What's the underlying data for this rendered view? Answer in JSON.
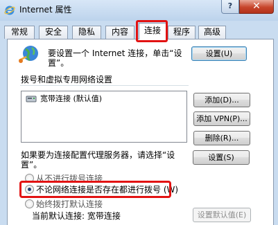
{
  "window": {
    "title": "Internet 属性",
    "help_label": "?",
    "close_label": "✕"
  },
  "tabs": [
    {
      "label": "常规"
    },
    {
      "label": "安全"
    },
    {
      "label": "隐私"
    },
    {
      "label": "内容"
    },
    {
      "label": "连接",
      "active": true
    },
    {
      "label": "程序"
    },
    {
      "label": "高级"
    }
  ],
  "setup": {
    "text_line1": "要设置一个 Internet 连接，单击“设",
    "text_line2": "置”。",
    "button": "设置(U)"
  },
  "dialup": {
    "section_label": "拨号和虚拟专用网络设置",
    "list_items": [
      {
        "label": "宽带连接 (默认值)"
      }
    ],
    "add_button": "添加(D)...",
    "add_vpn_button": "添加 VPN(P)...",
    "remove_button": "删除(R)...",
    "settings_button": "设置(S)"
  },
  "proxy": {
    "text_line1": "如果要为连接配置代理服务器，请选择“设",
    "text_line2": "置”。"
  },
  "dial_options": [
    {
      "label": "从不进行拨号连接",
      "checked": false
    },
    {
      "label": "不论网络连接是否存在都进行拨号 (W)",
      "checked": true
    },
    {
      "label": "始终拨打默认连接",
      "checked": false
    }
  ],
  "default_connection": {
    "label": "当前默认连接: 宽带连接",
    "set_default_button": "设置默认值(E)"
  },
  "colors": {
    "highlight": "#e21212",
    "close_button": "#c7452b",
    "window_frame": "#c9dcf0"
  }
}
